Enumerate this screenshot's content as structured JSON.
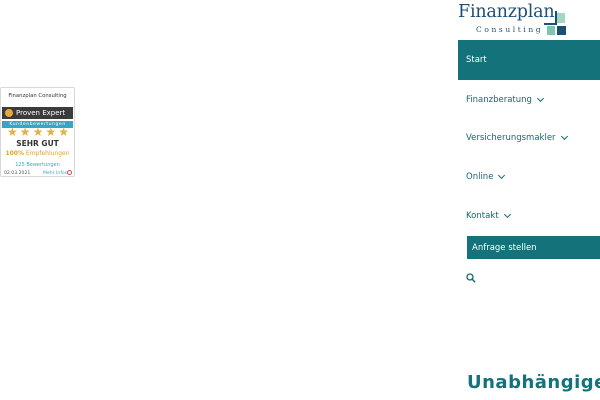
{
  "logo": {
    "name": "Finanzplan",
    "subtitle": "Consulting"
  },
  "nav": {
    "items": [
      {
        "label": "Start",
        "active": true,
        "dropdown": false
      },
      {
        "label": "Finanzberatung",
        "active": false,
        "dropdown": true
      },
      {
        "label": "Versicherungsmakler",
        "active": false,
        "dropdown": true
      },
      {
        "label": "Online",
        "active": false,
        "dropdown": true
      },
      {
        "label": "Kontakt",
        "active": false,
        "dropdown": true
      }
    ],
    "cta_label": "Anfrage stellen",
    "search_icon": "search-icon"
  },
  "headline": "Unabhängige",
  "widget": {
    "company": "Finanzplan Consulting",
    "brand": "Proven Expert",
    "reviews_label": "Kundenbewertungen",
    "stars": 5,
    "grade": "SEHR GUT",
    "recommendation_pct": "100%",
    "recommendation_label": "Empfehlungen",
    "review_count": "125 Bewertungen",
    "date": "02.03.2021",
    "more_link": "Mehr Infos"
  },
  "colors": {
    "teal": "#13727a",
    "navy": "#1d4f74",
    "gold": "#e0b144",
    "light_blue": "#3aa4c4"
  }
}
